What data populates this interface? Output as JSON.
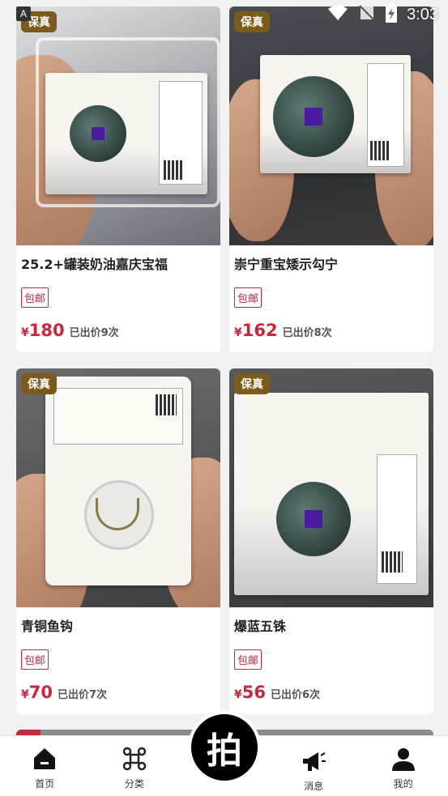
{
  "status_bar": {
    "time": "3:03"
  },
  "products": [
    {
      "badge": "保真",
      "title": "25.2+罐装奶油嘉庆宝福",
      "shipping": "包邮",
      "currency": "¥",
      "price": "180",
      "bids": "已出价9次"
    },
    {
      "badge": "保真",
      "title": "崇宁重宝矮示勾宁",
      "shipping": "包邮",
      "currency": "¥",
      "price": "162",
      "bids": "已出价8次"
    },
    {
      "badge": "保真",
      "title": "青铜鱼钩",
      "shipping": "包邮",
      "currency": "¥",
      "price": "70",
      "bids": "已出价7次"
    },
    {
      "badge": "保真",
      "title": "爆蓝五铢",
      "shipping": "包邮",
      "currency": "¥",
      "price": "56",
      "bids": "已出价6次"
    }
  ],
  "nav": {
    "home": "首页",
    "category": "分类",
    "auction": "拍",
    "messages": "消息",
    "mine": "我的"
  },
  "colors": {
    "accent": "#c8283c",
    "badge": "#7a5b1a",
    "active_nav": "#000000"
  },
  "icons": {
    "home": "home-icon",
    "category": "command-icon",
    "messages": "megaphone-icon",
    "mine": "user-icon",
    "status": [
      "wifi-icon",
      "no-signal-icon",
      "battery-charging-icon"
    ]
  }
}
